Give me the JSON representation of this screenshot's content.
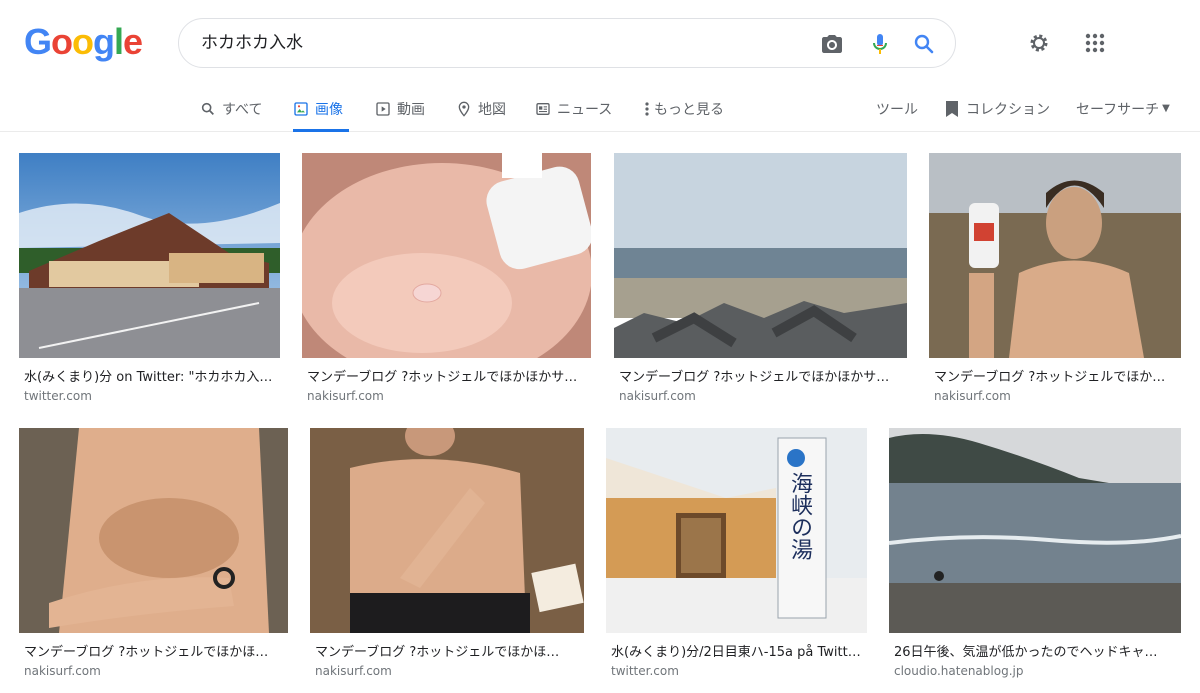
{
  "logo": {
    "letters": [
      "G",
      "o",
      "o",
      "g",
      "l",
      "e"
    ],
    "colors": [
      "#4285F4",
      "#EA4335",
      "#FBBC05",
      "#4285F4",
      "#34A853",
      "#EA4335"
    ]
  },
  "search": {
    "query": "ホカホカ入水",
    "camera_icon": "camera-icon",
    "mic_icon": "mic-icon",
    "search_icon": "search-icon"
  },
  "header": {
    "settings_icon": "gear-icon",
    "apps_icon": "apps-grid-icon"
  },
  "tabs": [
    {
      "label": "すべて",
      "icon": "search-icon"
    },
    {
      "label": "画像",
      "icon": "image-icon",
      "active": true
    },
    {
      "label": "動画",
      "icon": "video-icon"
    },
    {
      "label": "地図",
      "icon": "map-pin-icon"
    },
    {
      "label": "ニュース",
      "icon": "news-icon"
    },
    {
      "label": "もっと見る",
      "icon": "more-vert-icon"
    }
  ],
  "tools": {
    "tools_label": "ツール",
    "collections_label": "コレクション",
    "safesearch_label": "セーフサーチ"
  },
  "results": [
    {
      "title": "水(みくまり)分 on Twitter: \"ホカホカ入…",
      "site": "twitter.com"
    },
    {
      "title": "マンデーブログ ?ホットジェルでほかほかサ…",
      "site": "nakisurf.com"
    },
    {
      "title": "マンデーブログ ?ホットジェルでほかほかサ…",
      "site": "nakisurf.com"
    },
    {
      "title": "マンデーブログ ?ホットジェルでほか…",
      "site": "nakisurf.com"
    },
    {
      "title": "マンデーブログ ?ホットジェルでほかほ…",
      "site": "nakisurf.com"
    },
    {
      "title": "マンデーブログ ?ホットジェルでほかほ…",
      "site": "nakisurf.com"
    },
    {
      "title": "水(みくまり)分/2日目東ハ-15a på Twitt…",
      "site": "twitter.com"
    },
    {
      "title": "26日午後、気温が低かったのでヘッドキャ…",
      "site": "cloudio.hatenablog.jp"
    }
  ],
  "sign_text": "海峡の湯",
  "colors": {
    "accent": "#1a73e8",
    "text_secondary": "#70757a"
  }
}
